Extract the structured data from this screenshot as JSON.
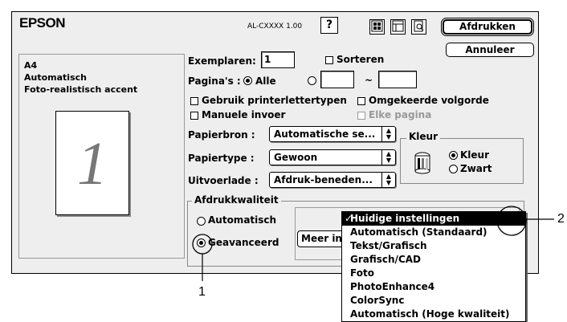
{
  "header": {
    "brand": "EPSON",
    "model": "AL-CXXXX 1.00",
    "help_glyph": "?",
    "print_button": "Afdrukken",
    "cancel_button": "Annuleer",
    "icons": [
      "layout-icon",
      "page-setup-icon",
      "preview-icon"
    ]
  },
  "summary": {
    "paper_size": "A4",
    "mode": "Automatisch",
    "setting": "Foto-realistisch accent",
    "preview_number": "1"
  },
  "form": {
    "copies_label": "Exemplaren:",
    "copies_value": "1",
    "collate_label": "Sorteren",
    "pages_label": "Pagina's :",
    "pages_all_label": "Alle",
    "pages_from_value": "",
    "pages_to_value": "",
    "range_tilde": "~",
    "printer_fonts_label": "Gebruik printerlettertypen",
    "reverse_order_label": "Omgekeerde volgorde",
    "manual_feed_label": "Manuele invoer",
    "every_page_label": "Elke pagina",
    "paper_source_label": "Papierbron :",
    "paper_source_value": "Automatische se...",
    "paper_type_label": "Papiertype :",
    "paper_type_value": "Gewoon",
    "output_tray_label": "Uitvoerlade :",
    "output_tray_value": "Afdruk-beneden..."
  },
  "color": {
    "group_title": "Kleur",
    "color_option": "Kleur",
    "bw_option": "Zwart"
  },
  "quality": {
    "group_title": "Afdrukkwaliteit",
    "auto_option": "Automatisch",
    "advanced_option": "Geavanceerd",
    "more_button": "Meer ins"
  },
  "menu": {
    "items": [
      "Huidige instellingen",
      "Automatisch (Standaard)",
      "Tekst/Grafisch",
      "Grafisch/CAD",
      "Foto",
      "PhotoEnhance4",
      "ColorSync",
      "Automatisch (Hoge kwaliteit)"
    ],
    "check": "✓"
  },
  "callouts": {
    "one": "1",
    "two": "2"
  }
}
